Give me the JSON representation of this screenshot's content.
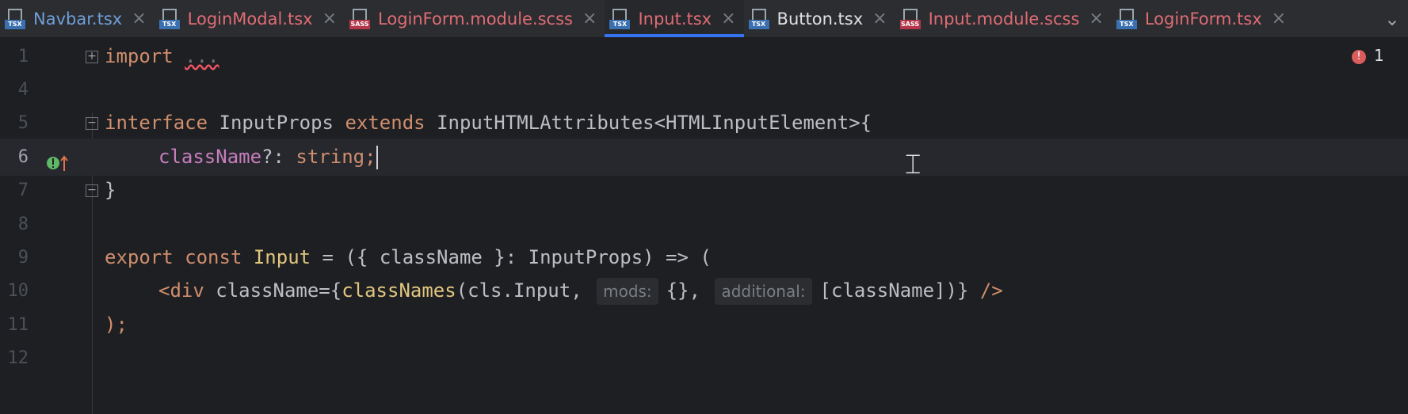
{
  "tabs": [
    {
      "label": "Navbar.tsx",
      "kind": "TSX",
      "color": "#6f9fd8",
      "active": false
    },
    {
      "label": "LoginModal.tsx",
      "kind": "TSX",
      "color": "#e06c75",
      "active": false
    },
    {
      "label": "LoginForm.module.scss",
      "kind": "SASS",
      "color": "#e06c75",
      "active": false
    },
    {
      "label": "Input.tsx",
      "kind": "TSX",
      "color": "#e06c75",
      "active": true
    },
    {
      "label": "Button.tsx",
      "kind": "TSX",
      "color": "#dfe1e5",
      "active": false
    },
    {
      "label": "Input.module.scss",
      "kind": "SASS",
      "color": "#e06c75",
      "active": false
    },
    {
      "label": "LoginForm.tsx",
      "kind": "TSX",
      "color": "#e06c75",
      "active": false
    }
  ],
  "icons": {
    "close": "×",
    "more": "⌄",
    "fold_expand": "+",
    "fold_collapse": "−",
    "error_badge": "!"
  },
  "inspection": {
    "error_count": "1"
  },
  "lines": {
    "l1": {
      "num": "1",
      "kw": "import",
      "rest": "..."
    },
    "l4": {
      "num": "4"
    },
    "l5": {
      "num": "5",
      "kw1": "interface",
      "name": "InputProps",
      "kw2": "extends",
      "type": "InputHTMLAttributes<HTMLInputElement>{"
    },
    "l6": {
      "num": "6",
      "prop": "className",
      "q": "?: ",
      "type": "string;"
    },
    "l7": {
      "num": "7",
      "brace": "}"
    },
    "l8": {
      "num": "8"
    },
    "l9": {
      "num": "9",
      "kw1": "export",
      "kw2": "const",
      "fn": "Input",
      "eq": " = ({ ",
      "param": "className",
      "rest": " }: InputProps) => ("
    },
    "l10": {
      "num": "10",
      "open": "<div ",
      "attr": "className",
      "eq": "={",
      "fn": "classNames",
      "args1": "(cls.Input, ",
      "hint1": "mods:",
      "args2": "{}, ",
      "hint2": "additional:",
      "args3": "[className])}",
      "close": " />"
    },
    "l11": {
      "num": "11",
      "text": ");"
    },
    "l12": {
      "num": "12"
    }
  }
}
